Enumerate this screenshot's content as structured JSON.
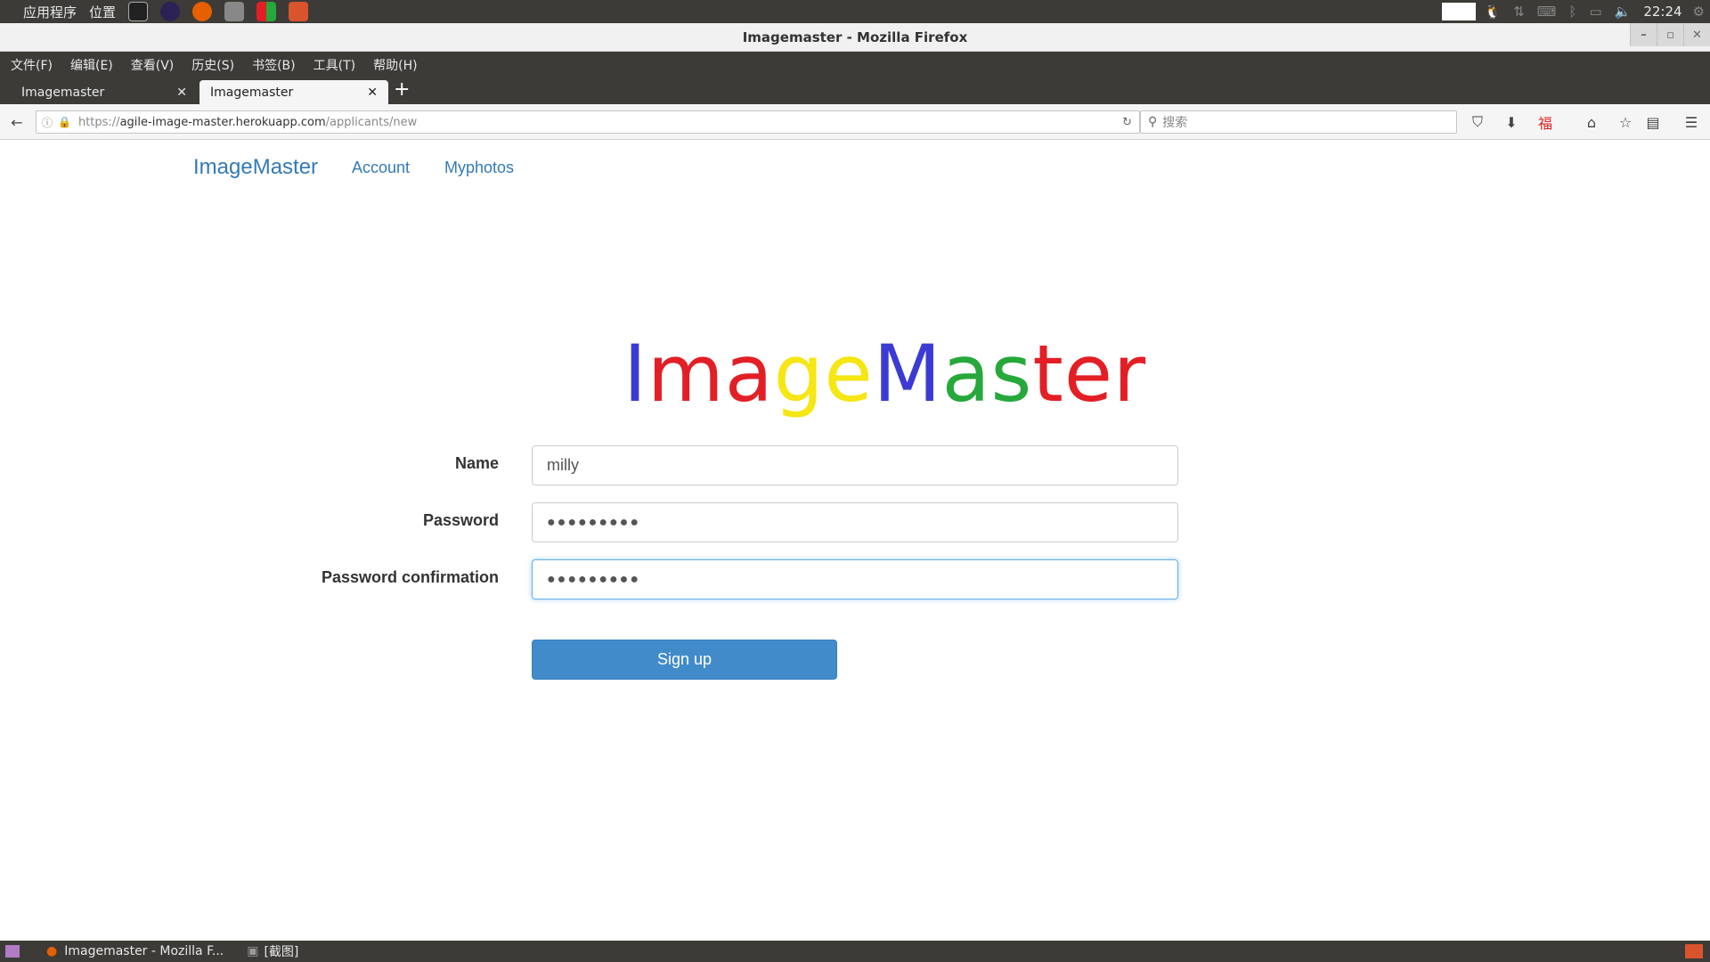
{
  "system_panel": {
    "apps_label": "应用程序",
    "places_label": "位置",
    "clock": "22:24"
  },
  "window": {
    "title": "Imagemaster - Mozilla Firefox"
  },
  "menubar": {
    "items": [
      "文件(F)",
      "编辑(E)",
      "查看(V)",
      "历史(S)",
      "书签(B)",
      "工具(T)",
      "帮助(H)"
    ]
  },
  "tabs": [
    {
      "label": "Imagemaster",
      "active": false
    },
    {
      "label": "Imagemaster",
      "active": true
    }
  ],
  "navbar": {
    "url_prefix": "https://",
    "url_host": "agile-image-master.herokuapp.com",
    "url_path": "/applicants/new",
    "search_placeholder": "搜索"
  },
  "site": {
    "brand": "ImageMaster",
    "nav_links": [
      "Account",
      "Myphotos"
    ],
    "logo_letters": [
      {
        "ch": "I",
        "color": "#3b3bd4"
      },
      {
        "ch": "m",
        "color": "#e31f26"
      },
      {
        "ch": "a",
        "color": "#e31f26"
      },
      {
        "ch": "g",
        "color": "#f5e614"
      },
      {
        "ch": "e",
        "color": "#f5e614"
      },
      {
        "ch": "M",
        "color": "#3b3bd4"
      },
      {
        "ch": "a",
        "color": "#26a83a"
      },
      {
        "ch": "s",
        "color": "#26a83a"
      },
      {
        "ch": "t",
        "color": "#e31f26"
      },
      {
        "ch": "e",
        "color": "#e31f26"
      },
      {
        "ch": "r",
        "color": "#e31f26"
      }
    ]
  },
  "form": {
    "name_label": "Name",
    "name_value": "milly",
    "password_label": "Password",
    "password_mask": "●●●●●●●●●",
    "confirm_label": "Password confirmation",
    "confirm_mask": "●●●●●●●●●",
    "submit_label": "Sign up"
  },
  "taskbar": {
    "items": [
      "Imagemaster - Mozilla F...",
      "[截图]"
    ]
  },
  "colors": {
    "link": "#337ab7",
    "button": "#428bca",
    "panel": "#3c3b37"
  }
}
